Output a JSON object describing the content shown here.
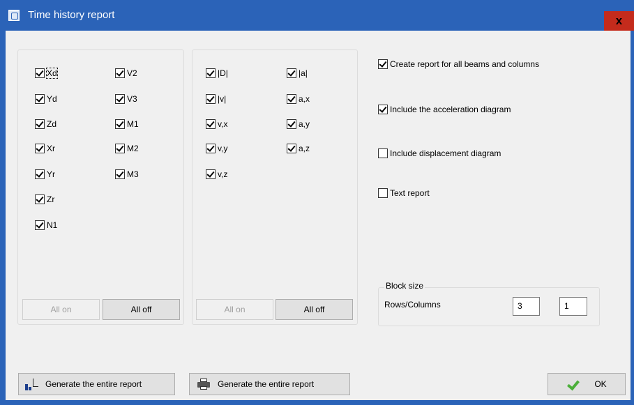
{
  "window": {
    "title": "Time history report",
    "close_label": "x"
  },
  "panel_left": {
    "col1": [
      "Xd",
      "Yd",
      "Zd",
      "Xr",
      "Yr",
      "Zr",
      "N1"
    ],
    "col2": [
      "V2",
      "V3",
      "M1",
      "M2",
      "M3"
    ],
    "all_on": "All on",
    "all_off": "All off"
  },
  "panel_middle": {
    "col1": [
      "|D|",
      "|v|",
      "v,x",
      "v,y",
      "v,z"
    ],
    "col2": [
      "|a|",
      "a,x",
      "a,y",
      "a,z"
    ],
    "all_on": "All on",
    "all_off": "All off"
  },
  "options": [
    {
      "label": "Create report for all beams and columns",
      "checked": true
    },
    {
      "label": "Include the acceleration diagram",
      "checked": true
    },
    {
      "label": "Include displacement diagram",
      "checked": false
    },
    {
      "label": "Text report",
      "checked": false
    }
  ],
  "block_size": {
    "legend": "Block size",
    "label": "Rows/Columns",
    "rows": "3",
    "columns": "1"
  },
  "buttons": {
    "generate_report": "Generate the entire report",
    "generate_print": "Generate the entire report",
    "ok": "OK"
  }
}
